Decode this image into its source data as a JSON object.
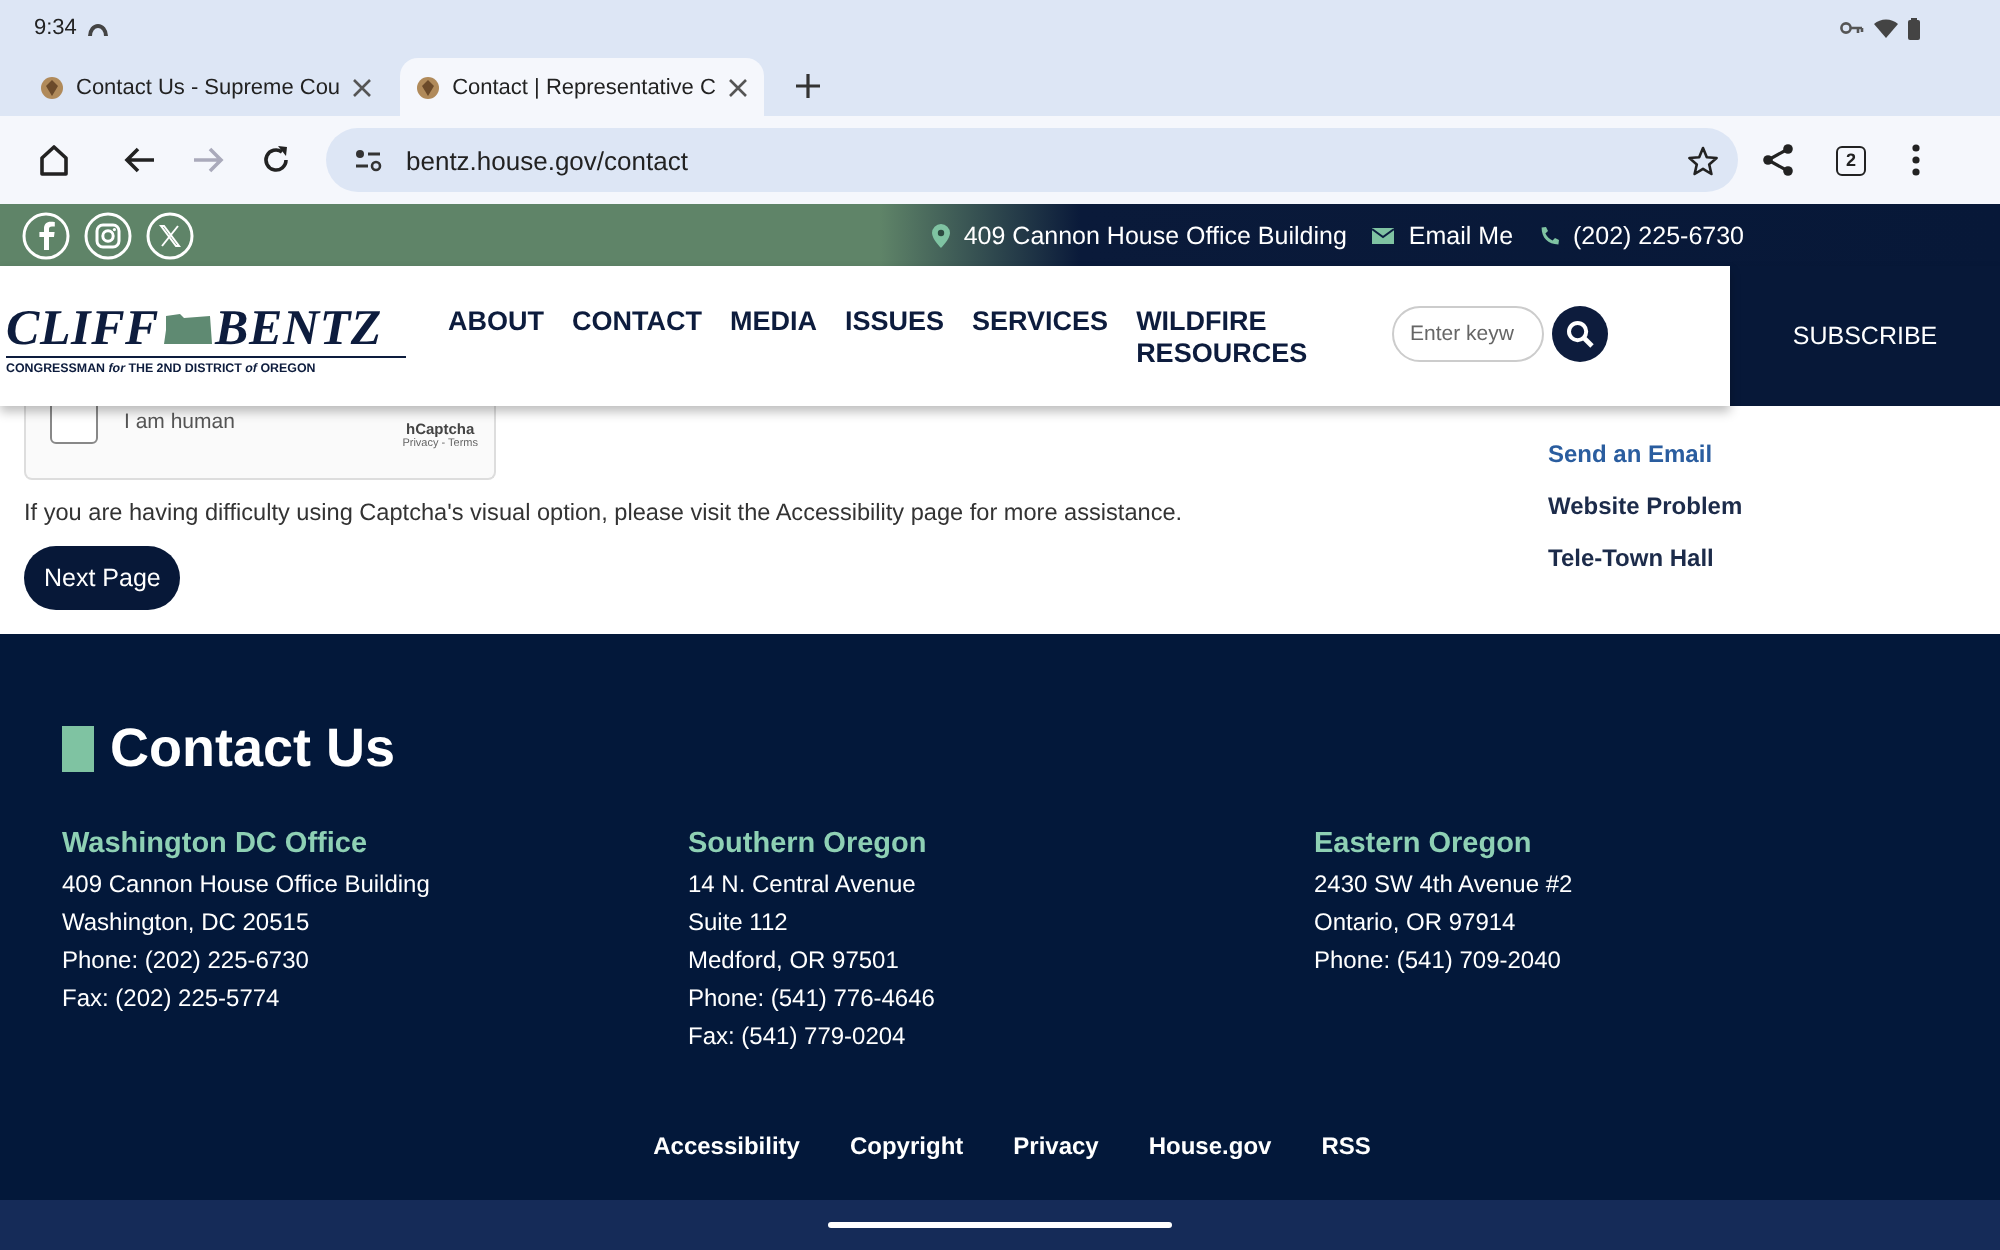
{
  "status_bar": {
    "time": "9:34"
  },
  "browser": {
    "tabs": [
      {
        "title": "Contact Us - Supreme Cou",
        "selected": false
      },
      {
        "title": "Contact | Representative C",
        "selected": true
      }
    ],
    "toolbar": {
      "forward_disabled": true,
      "url": "bentz.house.gov/contact",
      "tab_count": "2"
    }
  },
  "site_header": {
    "contact_bar": [
      {
        "kind": "pin",
        "text": "409 Cannon House Office Building"
      },
      {
        "kind": "mail",
        "text": "Email Me"
      },
      {
        "kind": "phone",
        "text": "(202) 225-6730"
      }
    ],
    "logo": {
      "first": "CLIFF",
      "last": "BENTZ",
      "tagline": "CONGRESSMAN *for* THE 2ND DISTRICT *of* OREGON"
    },
    "nav": [
      "ABOUT",
      "CONTACT",
      "MEDIA",
      "ISSUES",
      "SERVICES",
      "WILDFIRE RESOURCES"
    ],
    "search": {
      "placeholder": "Enter keyw"
    },
    "subscribe": "SUBSCRIBE"
  },
  "form": {
    "captcha": {
      "checked": false,
      "label": "I am human",
      "brand": "hCaptcha",
      "links": "Privacy - Terms"
    },
    "note": "If you are having difficulty using Captcha's visual option, please visit the Accessibility page for more assistance.",
    "button": "Next Page"
  },
  "sidebar": {
    "items": [
      {
        "label": "Send an Email",
        "selected": true
      },
      {
        "label": "Website Problem",
        "selected": false
      },
      {
        "label": "Tele-Town Hall",
        "selected": false
      }
    ]
  },
  "footer": {
    "title": "Contact Us",
    "offices": [
      {
        "name": "Washington DC Office",
        "lines": [
          "409 Cannon House Office Building",
          "Washington, DC 20515",
          "Phone: (202) 225-6730",
          "Fax: (202) 225-5774"
        ]
      },
      {
        "name": "Southern Oregon",
        "lines": [
          "14 N. Central Avenue",
          "Suite 112",
          "Medford, OR 97501",
          "Phone: (541) 776-4646",
          "Fax: (541) 779-0204"
        ]
      },
      {
        "name": "Eastern Oregon",
        "lines": [
          "2430 SW 4th Avenue #2",
          "Ontario, OR 97914",
          "Phone: (541) 709-2040"
        ]
      }
    ],
    "links": [
      "Accessibility",
      "Copyright",
      "Privacy",
      "House.gov",
      "RSS"
    ]
  }
}
